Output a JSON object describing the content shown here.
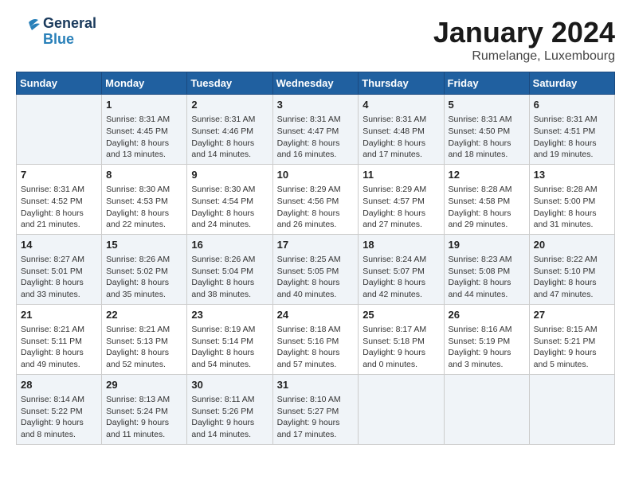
{
  "header": {
    "logo_line1": "General",
    "logo_line2": "Blue",
    "month": "January 2024",
    "location": "Rumelange, Luxembourg"
  },
  "days_of_week": [
    "Sunday",
    "Monday",
    "Tuesday",
    "Wednesday",
    "Thursday",
    "Friday",
    "Saturday"
  ],
  "weeks": [
    [
      {
        "day": "",
        "content": ""
      },
      {
        "day": "1",
        "content": "Sunrise: 8:31 AM\nSunset: 4:45 PM\nDaylight: 8 hours\nand 13 minutes."
      },
      {
        "day": "2",
        "content": "Sunrise: 8:31 AM\nSunset: 4:46 PM\nDaylight: 8 hours\nand 14 minutes."
      },
      {
        "day": "3",
        "content": "Sunrise: 8:31 AM\nSunset: 4:47 PM\nDaylight: 8 hours\nand 16 minutes."
      },
      {
        "day": "4",
        "content": "Sunrise: 8:31 AM\nSunset: 4:48 PM\nDaylight: 8 hours\nand 17 minutes."
      },
      {
        "day": "5",
        "content": "Sunrise: 8:31 AM\nSunset: 4:50 PM\nDaylight: 8 hours\nand 18 minutes."
      },
      {
        "day": "6",
        "content": "Sunrise: 8:31 AM\nSunset: 4:51 PM\nDaylight: 8 hours\nand 19 minutes."
      }
    ],
    [
      {
        "day": "7",
        "content": "Sunrise: 8:31 AM\nSunset: 4:52 PM\nDaylight: 8 hours\nand 21 minutes."
      },
      {
        "day": "8",
        "content": "Sunrise: 8:30 AM\nSunset: 4:53 PM\nDaylight: 8 hours\nand 22 minutes."
      },
      {
        "day": "9",
        "content": "Sunrise: 8:30 AM\nSunset: 4:54 PM\nDaylight: 8 hours\nand 24 minutes."
      },
      {
        "day": "10",
        "content": "Sunrise: 8:29 AM\nSunset: 4:56 PM\nDaylight: 8 hours\nand 26 minutes."
      },
      {
        "day": "11",
        "content": "Sunrise: 8:29 AM\nSunset: 4:57 PM\nDaylight: 8 hours\nand 27 minutes."
      },
      {
        "day": "12",
        "content": "Sunrise: 8:28 AM\nSunset: 4:58 PM\nDaylight: 8 hours\nand 29 minutes."
      },
      {
        "day": "13",
        "content": "Sunrise: 8:28 AM\nSunset: 5:00 PM\nDaylight: 8 hours\nand 31 minutes."
      }
    ],
    [
      {
        "day": "14",
        "content": "Sunrise: 8:27 AM\nSunset: 5:01 PM\nDaylight: 8 hours\nand 33 minutes."
      },
      {
        "day": "15",
        "content": "Sunrise: 8:26 AM\nSunset: 5:02 PM\nDaylight: 8 hours\nand 35 minutes."
      },
      {
        "day": "16",
        "content": "Sunrise: 8:26 AM\nSunset: 5:04 PM\nDaylight: 8 hours\nand 38 minutes."
      },
      {
        "day": "17",
        "content": "Sunrise: 8:25 AM\nSunset: 5:05 PM\nDaylight: 8 hours\nand 40 minutes."
      },
      {
        "day": "18",
        "content": "Sunrise: 8:24 AM\nSunset: 5:07 PM\nDaylight: 8 hours\nand 42 minutes."
      },
      {
        "day": "19",
        "content": "Sunrise: 8:23 AM\nSunset: 5:08 PM\nDaylight: 8 hours\nand 44 minutes."
      },
      {
        "day": "20",
        "content": "Sunrise: 8:22 AM\nSunset: 5:10 PM\nDaylight: 8 hours\nand 47 minutes."
      }
    ],
    [
      {
        "day": "21",
        "content": "Sunrise: 8:21 AM\nSunset: 5:11 PM\nDaylight: 8 hours\nand 49 minutes."
      },
      {
        "day": "22",
        "content": "Sunrise: 8:21 AM\nSunset: 5:13 PM\nDaylight: 8 hours\nand 52 minutes."
      },
      {
        "day": "23",
        "content": "Sunrise: 8:19 AM\nSunset: 5:14 PM\nDaylight: 8 hours\nand 54 minutes."
      },
      {
        "day": "24",
        "content": "Sunrise: 8:18 AM\nSunset: 5:16 PM\nDaylight: 8 hours\nand 57 minutes."
      },
      {
        "day": "25",
        "content": "Sunrise: 8:17 AM\nSunset: 5:18 PM\nDaylight: 9 hours\nand 0 minutes."
      },
      {
        "day": "26",
        "content": "Sunrise: 8:16 AM\nSunset: 5:19 PM\nDaylight: 9 hours\nand 3 minutes."
      },
      {
        "day": "27",
        "content": "Sunrise: 8:15 AM\nSunset: 5:21 PM\nDaylight: 9 hours\nand 5 minutes."
      }
    ],
    [
      {
        "day": "28",
        "content": "Sunrise: 8:14 AM\nSunset: 5:22 PM\nDaylight: 9 hours\nand 8 minutes."
      },
      {
        "day": "29",
        "content": "Sunrise: 8:13 AM\nSunset: 5:24 PM\nDaylight: 9 hours\nand 11 minutes."
      },
      {
        "day": "30",
        "content": "Sunrise: 8:11 AM\nSunset: 5:26 PM\nDaylight: 9 hours\nand 14 minutes."
      },
      {
        "day": "31",
        "content": "Sunrise: 8:10 AM\nSunset: 5:27 PM\nDaylight: 9 hours\nand 17 minutes."
      },
      {
        "day": "",
        "content": ""
      },
      {
        "day": "",
        "content": ""
      },
      {
        "day": "",
        "content": ""
      }
    ]
  ]
}
